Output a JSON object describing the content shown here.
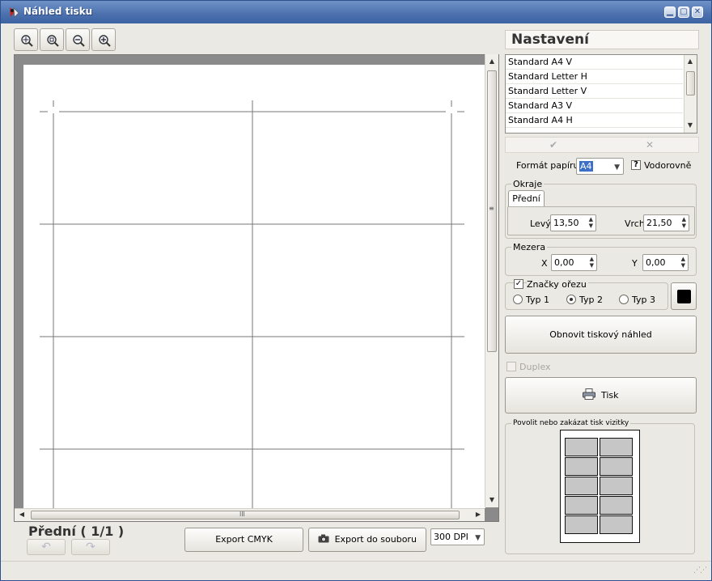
{
  "window": {
    "title": "Náhled tisku",
    "controls": {
      "minimize": "▁",
      "maximize": "▢",
      "close": "✕"
    }
  },
  "toolbar": {
    "zoom_buttons": [
      "zoom-fit-icon",
      "zoom-page-icon",
      "zoom-out-icon",
      "zoom-in-icon"
    ]
  },
  "preview": {
    "page_label": "Přední ( 1/1 )",
    "grip_h": "lll",
    "grip_v": "≡"
  },
  "bottom": {
    "export_cmyk": "Export CMYK",
    "export_file": "Export do souboru",
    "dpi": "300 DPI"
  },
  "settings": {
    "title": "Nastavení",
    "presets": [
      "Standard A4 V",
      "Standard Letter H",
      "Standard Letter V",
      "Standard A3 V",
      "Standard A4 H"
    ],
    "apply_icon": "✔",
    "delete_icon": "✕",
    "paper_format_label": "Formát papíru",
    "paper_format_value": "A4",
    "landscape_label": "Vodorovně",
    "margins": {
      "title": "Okraje",
      "tab": "Přední",
      "left_label": "Levý",
      "left_value": "13,50",
      "top_label": "Vrch",
      "top_value": "21,50"
    },
    "gap": {
      "title": "Mezera",
      "x_label": "X",
      "x_value": "0,00",
      "y_label": "Y",
      "y_value": "0,00"
    },
    "crop_marks": {
      "label": "Značky ořezu",
      "checked": true,
      "types": [
        "Typ 1",
        "Typ 2",
        "Typ 3"
      ],
      "selected": 1,
      "color": "#000000"
    },
    "refresh_button": "Obnovit tiskový náhled",
    "duplex_label": "Duplex",
    "print_button": "Tisk",
    "cards_group_title": "Povolit nebo zakázat tisk vizitky"
  }
}
